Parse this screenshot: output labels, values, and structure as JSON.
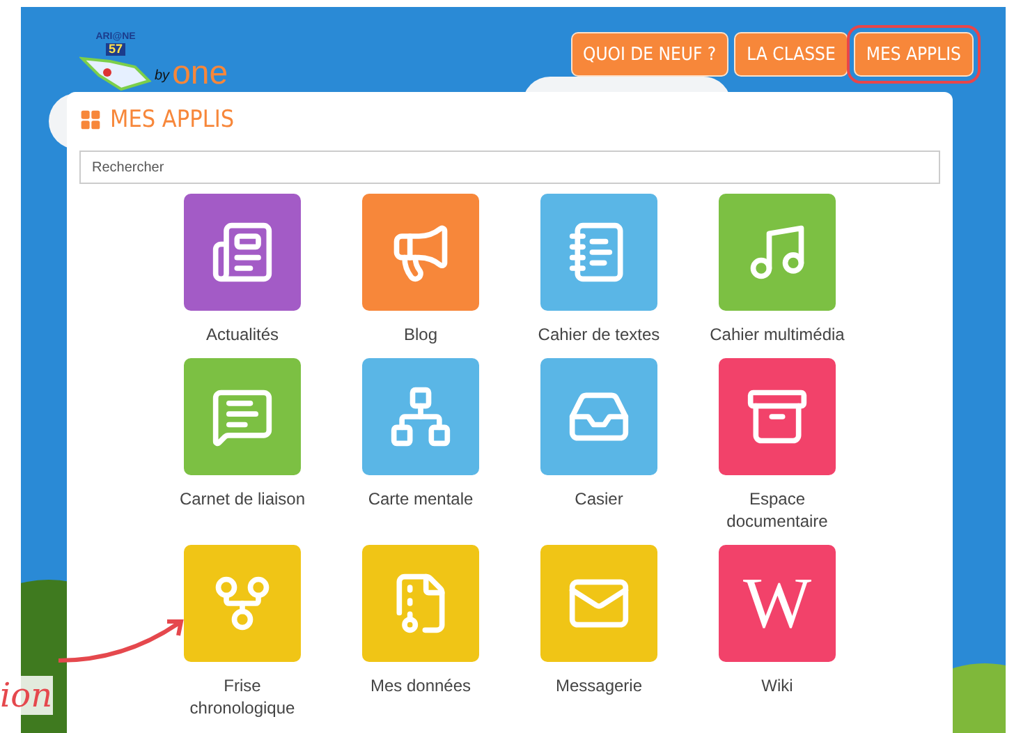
{
  "logo": {
    "name": "ARI@NE",
    "number": "57",
    "by": "by",
    "brand": "one"
  },
  "nav": [
    {
      "label": "QUOI DE NEUF ?",
      "circled": false
    },
    {
      "label": "LA CLASSE",
      "circled": false
    },
    {
      "label": "MES APPLIS",
      "circled": true
    }
  ],
  "panel": {
    "title": "MES APPLIS",
    "search": {
      "placeholder": "Rechercher"
    }
  },
  "apps": [
    {
      "label": "Actualités",
      "color": "#a35bc6"
    },
    {
      "label": "Blog",
      "color": "#f7873a"
    },
    {
      "label": "Cahier de textes",
      "color": "#5ab6e6"
    },
    {
      "label": "Cahier multimédia",
      "color": "#7cc043"
    },
    {
      "label": "Carnet de liaison",
      "color": "#7cc043"
    },
    {
      "label": "Carte mentale",
      "color": "#5ab6e6"
    },
    {
      "label": "Casier",
      "color": "#5ab6e6"
    },
    {
      "label": "Espace documentaire",
      "color": "#f2426a"
    },
    {
      "label": "Frise chronologique",
      "color": "#f0c516"
    },
    {
      "label": "Mes données",
      "color": "#f0c516"
    },
    {
      "label": "Messagerie",
      "color": "#f0c516"
    },
    {
      "label": "Wiki",
      "color": "#f2426a",
      "glyph": "W"
    }
  ],
  "annotation": {
    "text": "ion"
  }
}
